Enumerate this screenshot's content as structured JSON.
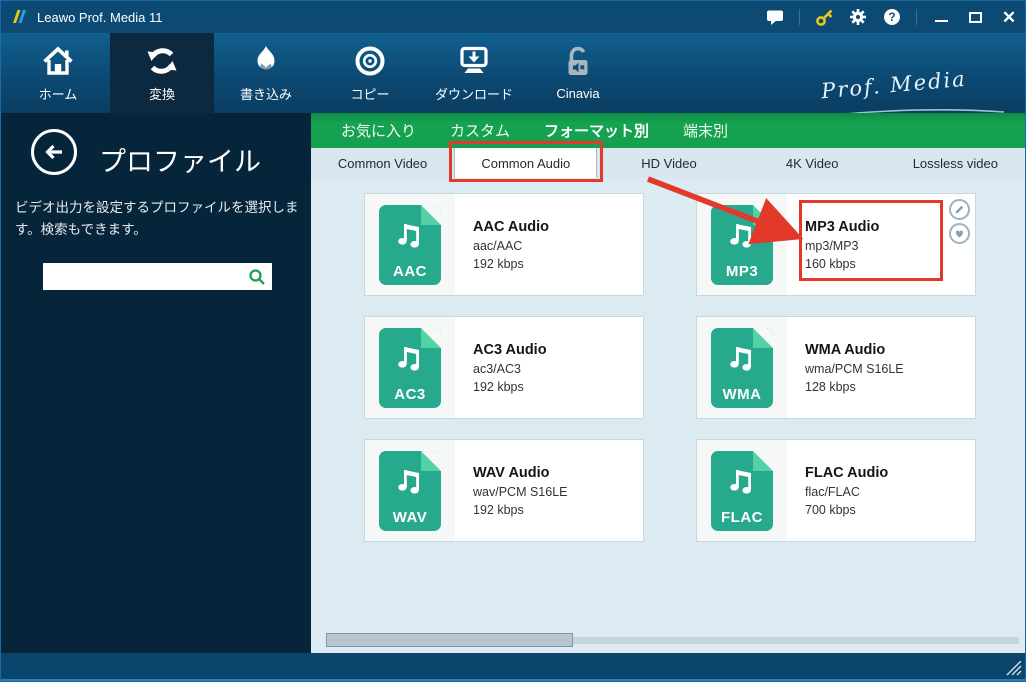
{
  "window": {
    "title": "Leawo Prof. Media 11",
    "brand_script": "Prof. Media"
  },
  "titlebar": {
    "icons": [
      "feedback",
      "register",
      "settings",
      "help"
    ],
    "window_controls": [
      "minimize",
      "maximize",
      "close"
    ],
    "help_glyph": "?"
  },
  "nav": {
    "items": [
      {
        "label": "ホーム",
        "icon": "home-icon",
        "active": false
      },
      {
        "label": "変換",
        "icon": "convert-icon",
        "active": true
      },
      {
        "label": "書き込み",
        "icon": "burn-icon",
        "active": false
      },
      {
        "label": "コピー",
        "icon": "copy-icon",
        "active": false
      },
      {
        "label": "ダウンロード",
        "icon": "download-icon",
        "active": false
      },
      {
        "label": "Cinavia",
        "icon": "cinavia-icon",
        "active": false
      }
    ]
  },
  "sidebar": {
    "title": "プロファイル",
    "description": "ビデオ出力を設定するプロファイルを選択します。検索もできます。",
    "search": {
      "value": "",
      "placeholder": ""
    }
  },
  "category_tabs": [
    {
      "label": "お気に入り",
      "active": false
    },
    {
      "label": "カスタム",
      "active": false
    },
    {
      "label": "フォーマット別",
      "active": true
    },
    {
      "label": "端末別",
      "active": false
    }
  ],
  "format_tabs": [
    {
      "label": "Common Video",
      "active": false
    },
    {
      "label": "Common Audio",
      "active": true
    },
    {
      "label": "HD Video",
      "active": false
    },
    {
      "label": "4K Video",
      "active": false
    },
    {
      "label": "Lossless video",
      "active": false
    }
  ],
  "profiles": [
    {
      "badge": "AAC",
      "title": "AAC Audio",
      "codec": "aac/AAC",
      "bitrate": "192 kbps"
    },
    {
      "badge": "MP3",
      "title": "MP3 Audio",
      "codec": "mp3/MP3",
      "bitrate": "160 kbps",
      "annotated": true,
      "actions": [
        "edit",
        "favorite"
      ]
    },
    {
      "badge": "AC3",
      "title": "AC3 Audio",
      "codec": "ac3/AC3",
      "bitrate": "192 kbps"
    },
    {
      "badge": "WMA",
      "title": "WMA Audio",
      "codec": "wma/PCM S16LE",
      "bitrate": "128 kbps"
    },
    {
      "badge": "WAV",
      "title": "WAV Audio",
      "codec": "wav/PCM S16LE",
      "bitrate": "192 kbps"
    },
    {
      "badge": "FLAC",
      "title": "FLAC Audio",
      "codec": "flac/FLAC",
      "bitrate": "700 kbps"
    }
  ],
  "colors": {
    "titlebar_blue": "#0c4a74",
    "sidebar_navy": "#06243a",
    "accent_green": "#14a04f",
    "file_icon_green": "#27a98d",
    "file_fold_green": "#55d2a5",
    "annotation_red": "#e2392b",
    "content_bg": "#dcebf2",
    "bottombar_blue": "#0a466b",
    "key_icon_yellow": "#ecc51c",
    "search_icon_green": "#1d9e50"
  }
}
